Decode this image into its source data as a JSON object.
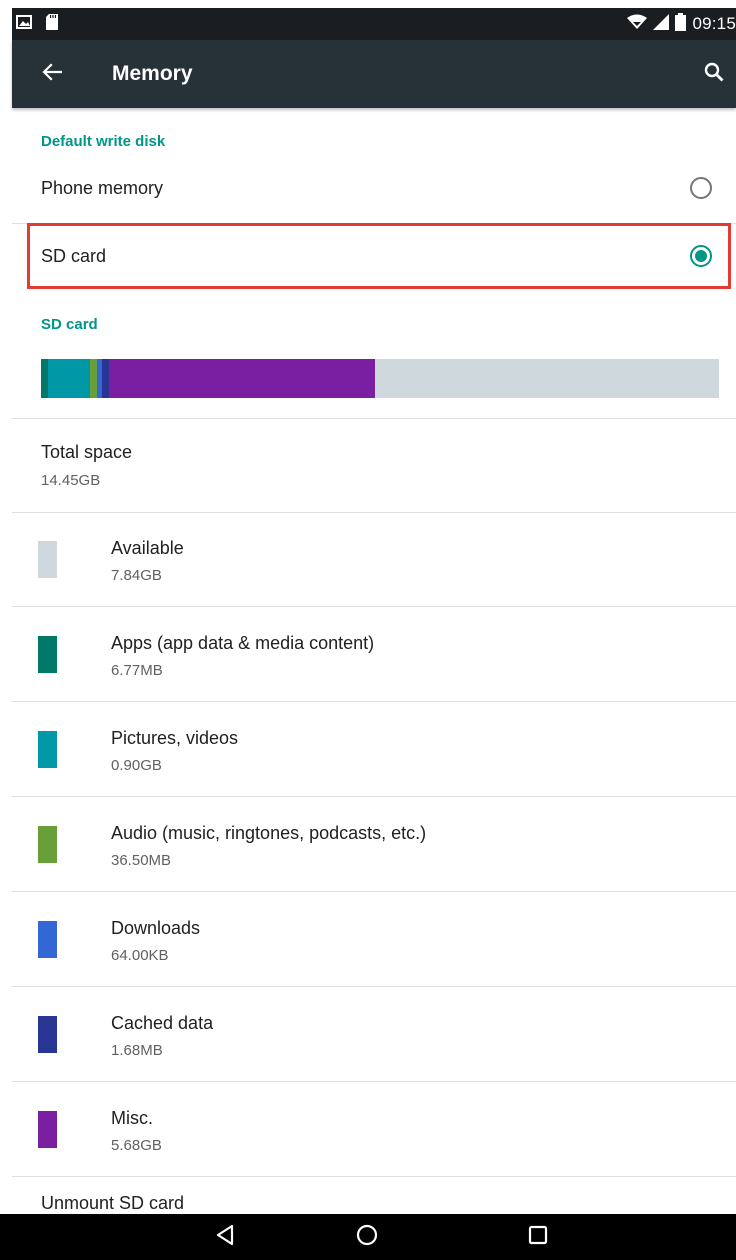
{
  "status_bar": {
    "time": "09:15",
    "icons": [
      "gallery-icon",
      "sd-card-icon",
      "wifi-icon",
      "signal-icon",
      "battery-icon"
    ]
  },
  "app_bar": {
    "title": "Memory",
    "back_icon": "arrow-left-icon",
    "search_icon": "search-icon"
  },
  "default_write_disk": {
    "header": "Default write disk",
    "options": [
      {
        "label": "Phone memory",
        "selected": false
      },
      {
        "label": "SD card",
        "selected": true
      }
    ]
  },
  "sd_card": {
    "header": "SD card",
    "usage_bar_segments": [
      {
        "name": "Apps",
        "fraction": 0.011,
        "color": "#00796b"
      },
      {
        "name": "Pictures, videos",
        "fraction": 0.062,
        "color": "#0097a7"
      },
      {
        "name": "Audio",
        "fraction": 0.009,
        "color": "#689f38"
      },
      {
        "name": "Downloads",
        "fraction": 0.008,
        "color": "#3367d6"
      },
      {
        "name": "Cached data",
        "fraction": 0.01,
        "color": "#283593"
      },
      {
        "name": "Misc.",
        "fraction": 0.393,
        "color": "#7b1fa2"
      }
    ],
    "usage_bar_free_color": "#cfd8dc",
    "total": {
      "title": "Total space",
      "value": "14.45GB"
    },
    "categories": [
      {
        "title": "Available",
        "value": "7.84GB",
        "color": "#cfd8dc"
      },
      {
        "title": "Apps (app data & media content)",
        "value": "6.77MB",
        "color": "#00796b"
      },
      {
        "title": "Pictures, videos",
        "value": "0.90GB",
        "color": "#0097a7"
      },
      {
        "title": "Audio (music, ringtones, podcasts, etc.)",
        "value": "36.50MB",
        "color": "#689f38"
      },
      {
        "title": "Downloads",
        "value": "64.00KB",
        "color": "#3367d6"
      },
      {
        "title": "Cached data",
        "value": "1.68MB",
        "color": "#283593"
      },
      {
        "title": "Misc.",
        "value": "5.68GB",
        "color": "#7b1fa2"
      }
    ],
    "unmount_label": "Unmount SD card"
  },
  "nav_bar": {
    "icons": [
      "back-triangle-icon",
      "home-circle-icon",
      "recents-square-icon"
    ]
  }
}
